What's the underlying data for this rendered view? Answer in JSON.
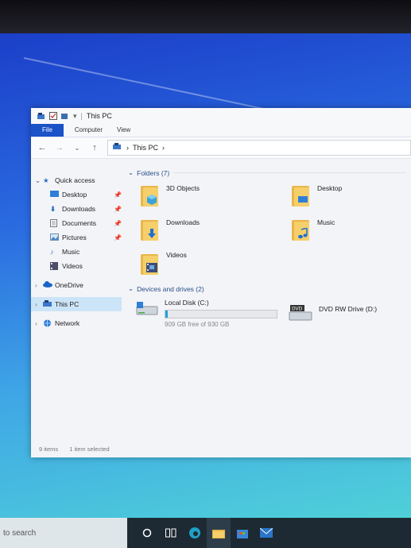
{
  "window": {
    "title": "This PC"
  },
  "ribbon": {
    "tabs": [
      "File",
      "Computer",
      "View"
    ]
  },
  "address_bar": {
    "path": "This PC",
    "chevron": "›"
  },
  "navigation": {
    "back": "←",
    "forward": "→",
    "recent": "⌄",
    "up": "↑"
  },
  "sidebar": {
    "quick_access": "Quick access",
    "items": [
      {
        "label": "Desktop",
        "icon": "desktop-icon",
        "pinned": true
      },
      {
        "label": "Downloads",
        "icon": "download-icon",
        "pinned": true
      },
      {
        "label": "Documents",
        "icon": "documents-icon",
        "pinned": true
      },
      {
        "label": "Pictures",
        "icon": "pictures-icon",
        "pinned": true
      },
      {
        "label": "Music",
        "icon": "music-icon",
        "pinned": false
      },
      {
        "label": "Videos",
        "icon": "videos-icon",
        "pinned": false
      }
    ],
    "onedrive": "OneDrive",
    "this_pc": "This PC",
    "network": "Network"
  },
  "folders": {
    "header": "Folders (7)",
    "items": [
      {
        "label": "3D Objects",
        "icon": "3d-objects-icon"
      },
      {
        "label": "Desktop",
        "icon": "desktop-folder-icon"
      },
      {
        "label": "Downloads",
        "icon": "downloads-folder-icon"
      },
      {
        "label": "Music",
        "icon": "music-folder-icon"
      },
      {
        "label": "Videos",
        "icon": "videos-folder-icon"
      }
    ]
  },
  "drives": {
    "header": "Devices and drives (2)",
    "local": {
      "label": "Local Disk (C:)",
      "free_text": "909 GB free of 930 GB",
      "used_fraction": 0.0226
    },
    "dvd": {
      "label": "DVD RW Drive (D:)",
      "badge": "DVD"
    }
  },
  "status": {
    "count": "9 items",
    "selection": "1 item selected"
  },
  "taskbar": {
    "search_placeholder": "to search"
  },
  "colors": {
    "accent": "#1a52c8",
    "selection": "#cce4f7",
    "progress": "#26a0da"
  }
}
